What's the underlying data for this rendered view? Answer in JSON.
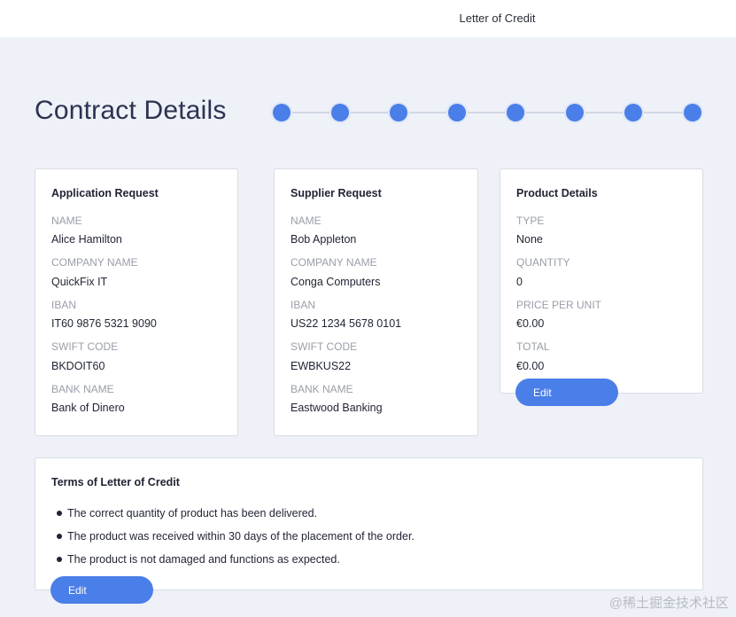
{
  "header": {
    "title": "Letter of Credit"
  },
  "page": {
    "title": "Contract Details"
  },
  "stepper": {
    "steps": 8,
    "accent": "#4a7ee8"
  },
  "application": {
    "title": "Application Request",
    "fields": [
      {
        "label": "NAME",
        "value": "Alice Hamilton"
      },
      {
        "label": "COMPANY NAME",
        "value": "QuickFix IT"
      },
      {
        "label": "IBAN",
        "value": "IT60 9876 5321 9090"
      },
      {
        "label": "SWIFT CODE",
        "value": "BKDOIT60"
      },
      {
        "label": "BANK NAME",
        "value": "Bank of Dinero"
      }
    ]
  },
  "supplier": {
    "title": "Supplier Request",
    "fields": [
      {
        "label": "NAME",
        "value": "Bob Appleton"
      },
      {
        "label": "COMPANY NAME",
        "value": "Conga Computers"
      },
      {
        "label": "IBAN",
        "value": "US22 1234 5678 0101"
      },
      {
        "label": "SWIFT CODE",
        "value": "EWBKUS22"
      },
      {
        "label": "BANK NAME",
        "value": "Eastwood Banking"
      }
    ]
  },
  "product": {
    "title": "Product Details",
    "fields": [
      {
        "label": "TYPE",
        "value": "None"
      },
      {
        "label": "QUANTITY",
        "value": "0"
      },
      {
        "label": "PRICE PER UNIT",
        "value": "€0.00"
      },
      {
        "label": "TOTAL",
        "value": "€0.00"
      }
    ],
    "edit_label": "Edit"
  },
  "terms": {
    "title": "Terms of Letter of Credit",
    "items": [
      "The correct quantity of product has been delivered.",
      "The product was received within 30 days of the placement of the order.",
      "The product is not damaged and functions as expected."
    ],
    "edit_label": "Edit"
  },
  "watermark": "@稀土掘金技术社区"
}
